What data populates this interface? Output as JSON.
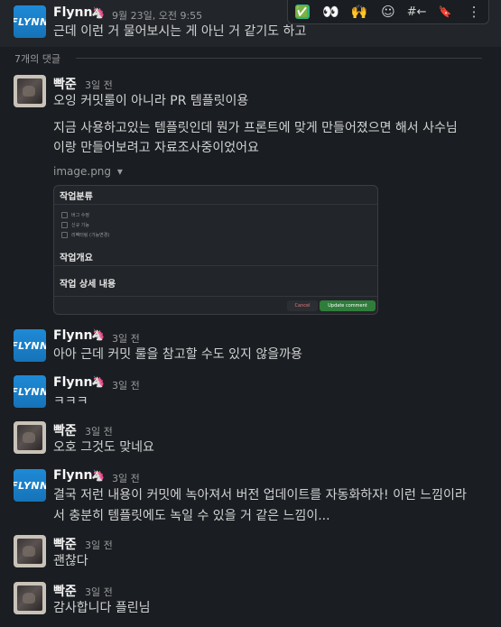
{
  "toolbar": {
    "check_icon": "✅",
    "eyes_icon": "👀",
    "raised_hands_icon": "🙌",
    "add_reaction_icon": "☺",
    "reply_icon": "#←",
    "bookmark_icon": "🔖",
    "more_icon": "⋮"
  },
  "parent": {
    "name": "Flynn",
    "badge": "🦄",
    "time": "9월 23일, 오전 9:55",
    "text": "근데 이런 거 물어보시는 게 아닌 거 같기도 하고"
  },
  "replies_label": "7개의 댓글",
  "avatars": {
    "flynn_text": "FLYNN"
  },
  "messages": [
    {
      "name": "빡준",
      "time": "3일 전",
      "line1": "오잉 커밋룰이 아니라 PR 템플릿이용",
      "line2": "지금 사용하고있는 템플릿인데 뭔가 프론트에 맞게 만들어졌으면 해서 사수님",
      "line3": "이랑 만들어보려고 자료조사중이었어요"
    },
    {
      "name": "Flynn",
      "badge": "🦄",
      "time": "3일 전",
      "text": "아아 근데 커밋 룰을 참고할 수도 있지 않을까용"
    },
    {
      "name": "Flynn",
      "badge": "🦄",
      "time": "3일 전",
      "text": "ㅋㅋㅋ"
    },
    {
      "name": "빡준",
      "time": "3일 전",
      "text": "오호 그것도 맞네요"
    },
    {
      "name": "Flynn",
      "badge": "🦄",
      "time": "3일 전",
      "line1": "결국 저런 내용이 커밋에 녹아져서 버전 업데이트를 자동화하자! 이런 느낌이라",
      "line2": "서 충분히 템플릿에도 녹일 수 있을 거 같은 느낌이..."
    },
    {
      "name": "빡준",
      "time": "3일 전",
      "text": "괜찮다"
    },
    {
      "name": "빡준",
      "time": "3일 전",
      "text": "감사합니다 플린님"
    }
  ],
  "attachment": {
    "filename": "image.png",
    "caret": "▾",
    "heading1": "작업분류",
    "checks": [
      "버그 수정",
      "신규 기능",
      "리팩터링 (기능변경)"
    ],
    "heading2": "작업개요",
    "heading3": "작업 상세 내용",
    "cancel_label": "Cancel",
    "update_label": "Update comment"
  }
}
